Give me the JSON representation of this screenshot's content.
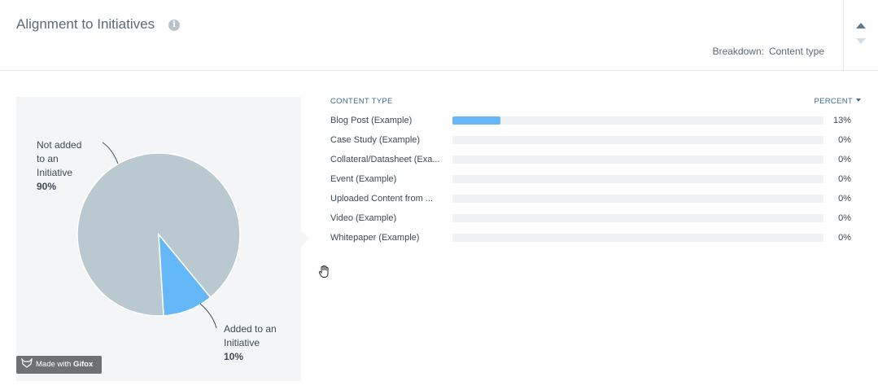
{
  "header": {
    "title": "Alignment to Initiatives",
    "info_icon": "info-icon",
    "breakdown_label": "Breakdown:",
    "breakdown_value": "Content type"
  },
  "controls": {
    "up_icon": "triangle-up-icon",
    "down_icon": "triangle-down-icon"
  },
  "pie": {
    "slices": [
      {
        "label_line1": "Not added",
        "label_line2": "to an",
        "label_line3": "Initiative",
        "percent_label": "90%",
        "value": 90,
        "color": "#bac8d0"
      },
      {
        "label_line1": "Added to an",
        "label_line2": "Initiative",
        "percent_label": "10%",
        "value": 10,
        "color": "#64b8f8"
      }
    ]
  },
  "table": {
    "col_type": "CONTENT TYPE",
    "col_percent": "PERCENT",
    "bar_color": "#64b8f8",
    "rows": [
      {
        "label": "Blog Post (Example)",
        "percent": 13,
        "display": "13%"
      },
      {
        "label": "Case Study (Example)",
        "percent": 0,
        "display": "0%"
      },
      {
        "label": "Collateral/Datasheet (Exa...",
        "percent": 0,
        "display": "0%"
      },
      {
        "label": "Event (Example)",
        "percent": 0,
        "display": "0%"
      },
      {
        "label": "Uploaded Content from ...",
        "percent": 0,
        "display": "0%"
      },
      {
        "label": "Video (Example)",
        "percent": 0,
        "display": "0%"
      },
      {
        "label": "Whitepaper (Example)",
        "percent": 0,
        "display": "0%"
      }
    ]
  },
  "watermark": {
    "prefix": "Made with",
    "brand": "Gifox"
  }
}
